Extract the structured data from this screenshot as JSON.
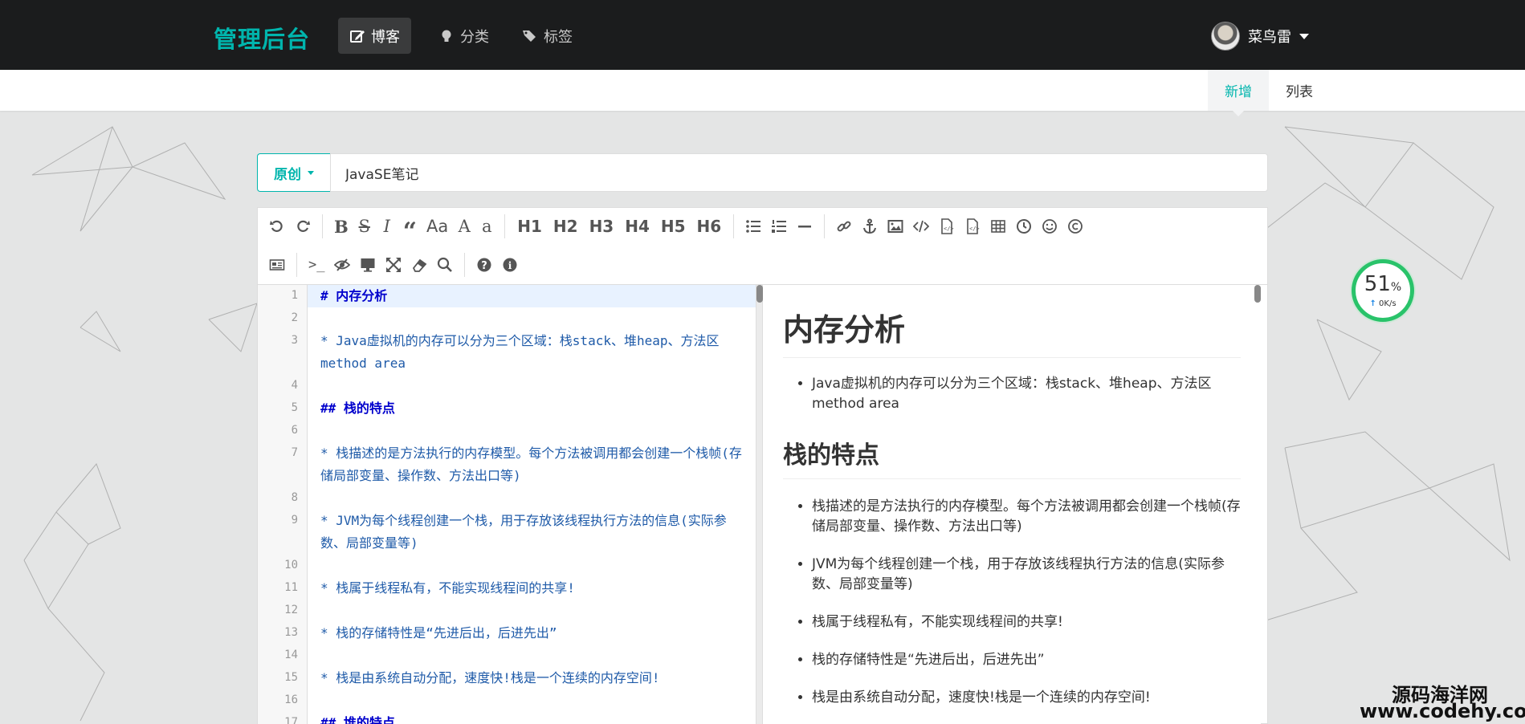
{
  "header": {
    "brand": "管理后台",
    "nav": [
      {
        "label": "博客",
        "icon": "edit-icon"
      },
      {
        "label": "分类",
        "icon": "lightbulb-icon"
      },
      {
        "label": "标签",
        "icon": "tags-icon"
      }
    ],
    "user_name": "菜鸟雷"
  },
  "subnav": {
    "tabs": [
      "新增",
      "列表"
    ]
  },
  "form": {
    "type_label": "原创",
    "title_value": "JavaSE笔记"
  },
  "toolbar": {
    "headings": [
      "H1",
      "H2",
      "H3",
      "H4",
      "H5",
      "H6"
    ]
  },
  "editor": {
    "lines": [
      {
        "n": "1",
        "text": "# 内存分析"
      },
      {
        "n": "2",
        "text": ""
      },
      {
        "n": "3",
        "text": "* Java虚拟机的内存可以分为三个区域：栈stack、堆heap、方法区method area"
      },
      {
        "n": "4",
        "text": ""
      },
      {
        "n": "5",
        "text": "## 栈的特点"
      },
      {
        "n": "6",
        "text": ""
      },
      {
        "n": "7",
        "text": "* 栈描述的是方法执行的内存模型。每个方法被调用都会创建一个栈帧(存储局部变量、操作数、方法出口等)"
      },
      {
        "n": "8",
        "text": ""
      },
      {
        "n": "9",
        "text": "* JVM为每个线程创建一个栈，用于存放该线程执行方法的信息(实际参数、局部变量等)"
      },
      {
        "n": "10",
        "text": ""
      },
      {
        "n": "11",
        "text": "* 栈属于线程私有，不能实现线程间的共享!"
      },
      {
        "n": "12",
        "text": ""
      },
      {
        "n": "13",
        "text": "* 栈的存储特性是“先进后出，后进先出”"
      },
      {
        "n": "14",
        "text": ""
      },
      {
        "n": "15",
        "text": "* 栈是由系统自动分配，速度快!栈是一个连续的内存空间!"
      },
      {
        "n": "16",
        "text": ""
      },
      {
        "n": "17",
        "text": "## 堆的特点"
      }
    ]
  },
  "preview": {
    "h1": "内存分析",
    "list1": [
      "Java虚拟机的内存可以分为三个区域：栈stack、堆heap、方法区method area"
    ],
    "h2": "栈的特点",
    "list2": [
      "栈描述的是方法执行的内存模型。每个方法被调用都会创建一个栈帧(存储局部变量、操作数、方法出口等)",
      "JVM为每个线程创建一个栈，用于存放该线程执行方法的信息(实际参数、局部变量等)",
      "栈属于线程私有，不能实现线程间的共享!",
      "栈的存储特性是“先进后出，后进先出”",
      "栈是由系统自动分配，速度快!栈是一个连续的内存空间!"
    ]
  },
  "speed_widget": {
    "percent": "51",
    "percent_unit": "%",
    "rate": "0K/s"
  },
  "watermark": {
    "name": "源码海洋网",
    "url": "www.codehy.com"
  },
  "colors": {
    "accent": "#00b5ad",
    "topbar": "#1b1c1d",
    "code_text": "#1e5aa8",
    "heading_code": "#0000cc"
  }
}
